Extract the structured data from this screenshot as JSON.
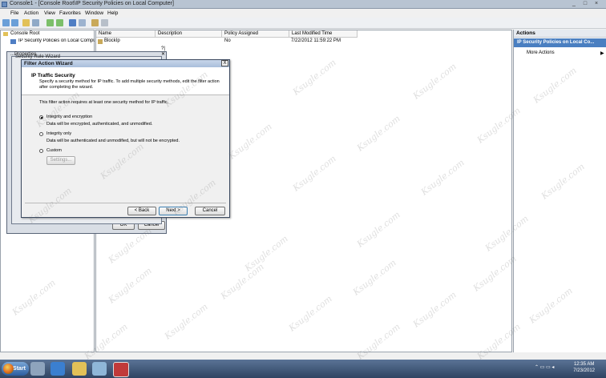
{
  "window": {
    "title": "Console1 - [Console Root\\IP Security Policies on Local Computer]"
  },
  "menu": [
    "File",
    "Action",
    "View",
    "Favorites",
    "Window",
    "Help"
  ],
  "tree": {
    "root": "Console Root",
    "child": "IP Security Policies on Local Computer"
  },
  "table": {
    "columns": [
      "Name",
      "Description",
      "Policy Assigned",
      "Last Modified Time"
    ],
    "rows": [
      {
        "name": "BlockIp",
        "description": "",
        "assigned": "No",
        "modified": "7/22/2012 11:59:22 PM"
      }
    ]
  },
  "actions": {
    "header": "Actions",
    "section": "IP Security Policies on Local Co...",
    "item": "More Actions"
  },
  "back_dialogs": {
    "d1_title": "...Properties",
    "d2_title": "Security Rule Wizard",
    "ok": "OK",
    "cancel": "Cancel"
  },
  "wizard": {
    "title": "Filter Action Wizard",
    "close": "X",
    "heading": "IP Traffic Security",
    "description": "Specify a security method for IP traffic. To add multiple security methods, edit the filter action after completing the wizard.",
    "intro": "This filter action requires at least one security method for IP traffic.",
    "options": [
      {
        "label": "Integrity and encryption",
        "desc": "Data will be encrypted, authenticated, and unmodified.",
        "selected": true
      },
      {
        "label": "Integrity only",
        "desc": "Data will be authenticated and unmodified, but will not be encrypted.",
        "selected": false
      },
      {
        "label": "Custom",
        "desc": "",
        "selected": false
      }
    ],
    "settings": "Settings...",
    "back": "< Back",
    "next": "Next >",
    "cancel": "Cancel"
  },
  "taskbar": {
    "start": "Start",
    "time": "12:35 AM",
    "date": "7/23/2012"
  },
  "watermark": "Ksugle.com"
}
